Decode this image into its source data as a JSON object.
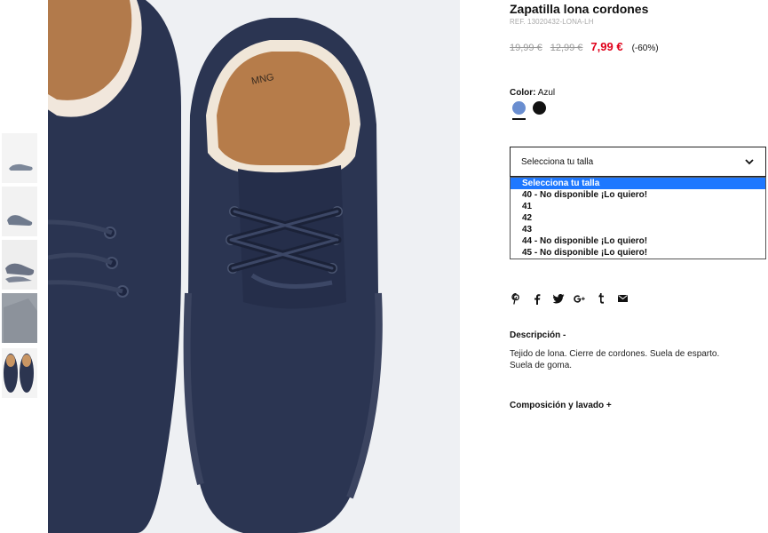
{
  "product": {
    "title": "Zapatilla lona cordones",
    "ref": "REF. 13020432-LONA-LH",
    "price_old_1": "19,99 €",
    "price_old_2": "12,99 €",
    "price_now": "7,99 €",
    "discount": "(-60%)"
  },
  "color": {
    "label": "Color:",
    "value": "Azul",
    "swatches": [
      "#6a8ed0",
      "#111111"
    ]
  },
  "size": {
    "placeholder": "Selecciona tu talla",
    "options": [
      "Selecciona tu talla",
      "40 - No disponible ¡Lo quiero!",
      "41",
      "42",
      "43",
      "44 - No disponible ¡Lo quiero!",
      "45 - No disponible ¡Lo quiero!"
    ],
    "selected_index": 0
  },
  "share_icons": [
    "pinterest-icon",
    "facebook-icon",
    "twitter-icon",
    "google-plus-icon",
    "tumblr-icon",
    "email-icon"
  ],
  "description": {
    "heading": "Descripción -",
    "text": "Tejido de lona. Cierre de cordones. Suela de esparto. Suela de goma."
  },
  "composition": {
    "heading": "Composición y lavado +"
  },
  "brand_mark": "MNG"
}
